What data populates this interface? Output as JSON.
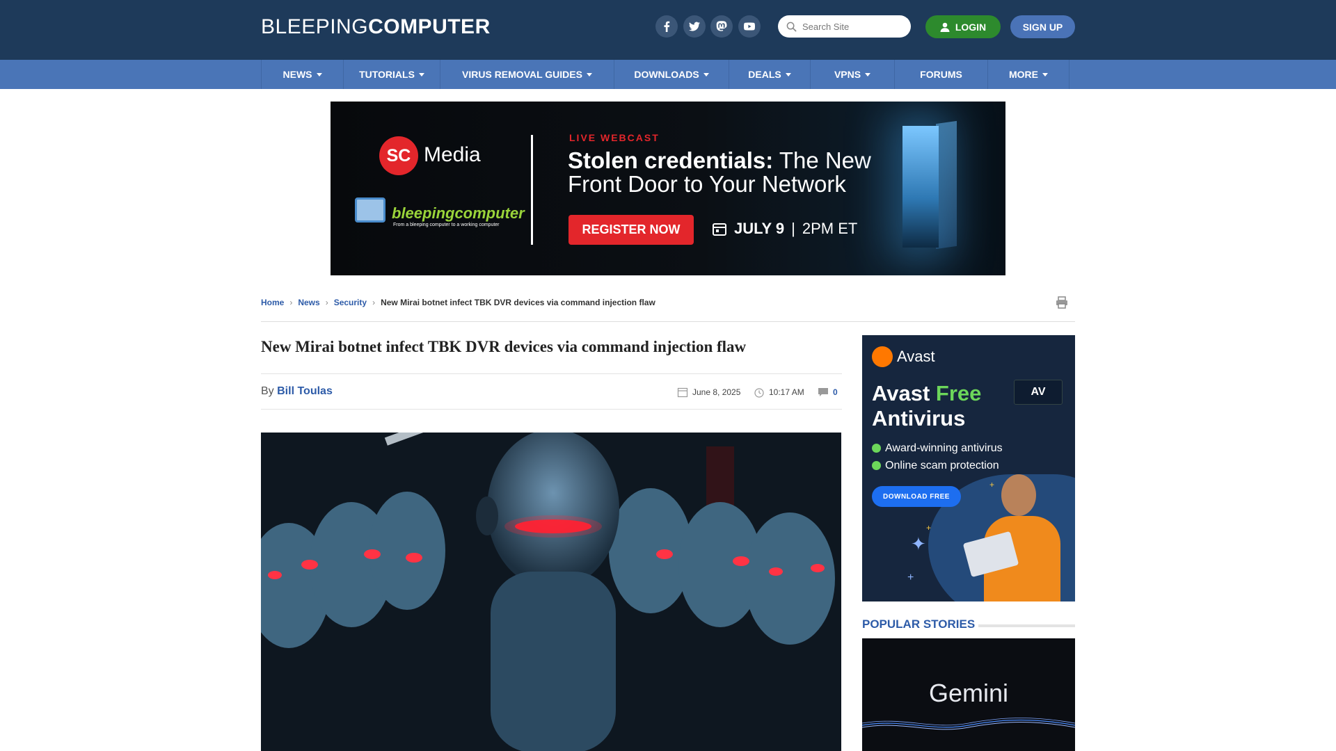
{
  "header": {
    "logo_light": "BLEEPING",
    "logo_bold": "COMPUTER",
    "social": [
      "facebook-icon",
      "twitter-icon",
      "mastodon-icon",
      "youtube-icon"
    ],
    "search_placeholder": "Search Site",
    "login_label": "LOGIN",
    "signup_label": "SIGN UP"
  },
  "nav": {
    "items": [
      {
        "label": "NEWS",
        "dropdown": true
      },
      {
        "label": "TUTORIALS",
        "dropdown": true
      },
      {
        "label": "VIRUS REMOVAL GUIDES",
        "dropdown": true
      },
      {
        "label": "DOWNLOADS",
        "dropdown": true
      },
      {
        "label": "DEALS",
        "dropdown": true
      },
      {
        "label": "VPNS",
        "dropdown": true
      },
      {
        "label": "FORUMS",
        "dropdown": false
      },
      {
        "label": "MORE",
        "dropdown": true
      }
    ]
  },
  "top_ad": {
    "sc_badge": "SC",
    "sc_media": "Media",
    "bc_logo": "bleepingcomputer",
    "bc_tagline": "From a bleeping computer to a working computer",
    "kicker": "LIVE WEBCAST",
    "headline_bold": "Stolen credentials:",
    "headline_rest_1": " The New",
    "headline_rest_2": "Front Door to Your Network",
    "cta": "REGISTER NOW",
    "date": "JULY 9",
    "time": "2PM ET"
  },
  "breadcrumb": {
    "home": "Home",
    "news": "News",
    "security": "Security",
    "current": "New Mirai botnet infect TBK DVR devices via command injection flaw"
  },
  "article": {
    "title": "New Mirai botnet infect TBK DVR devices via command injection flaw",
    "by": "By",
    "author": "Bill Toulas",
    "date": "June 8, 2025",
    "time": "10:17 AM",
    "comments": "0"
  },
  "side_ad": {
    "brand": "Avast",
    "title_1": "Avast ",
    "title_free": "Free",
    "title_2": "Antivirus",
    "badge": "AV",
    "bullets": [
      "Award-winning antivirus",
      "Online scam protection"
    ],
    "cta": "DOWNLOAD FREE"
  },
  "popular": {
    "title": "POPULAR STORIES",
    "first_image_text": "Gemini"
  },
  "colors": {
    "header_bg": "#1e3a5a",
    "nav_bg": "#4a75b7",
    "link": "#2d5ba8",
    "login": "#2d8a2d",
    "signup": "#4a73b7",
    "ad_red": "#e3262b"
  }
}
